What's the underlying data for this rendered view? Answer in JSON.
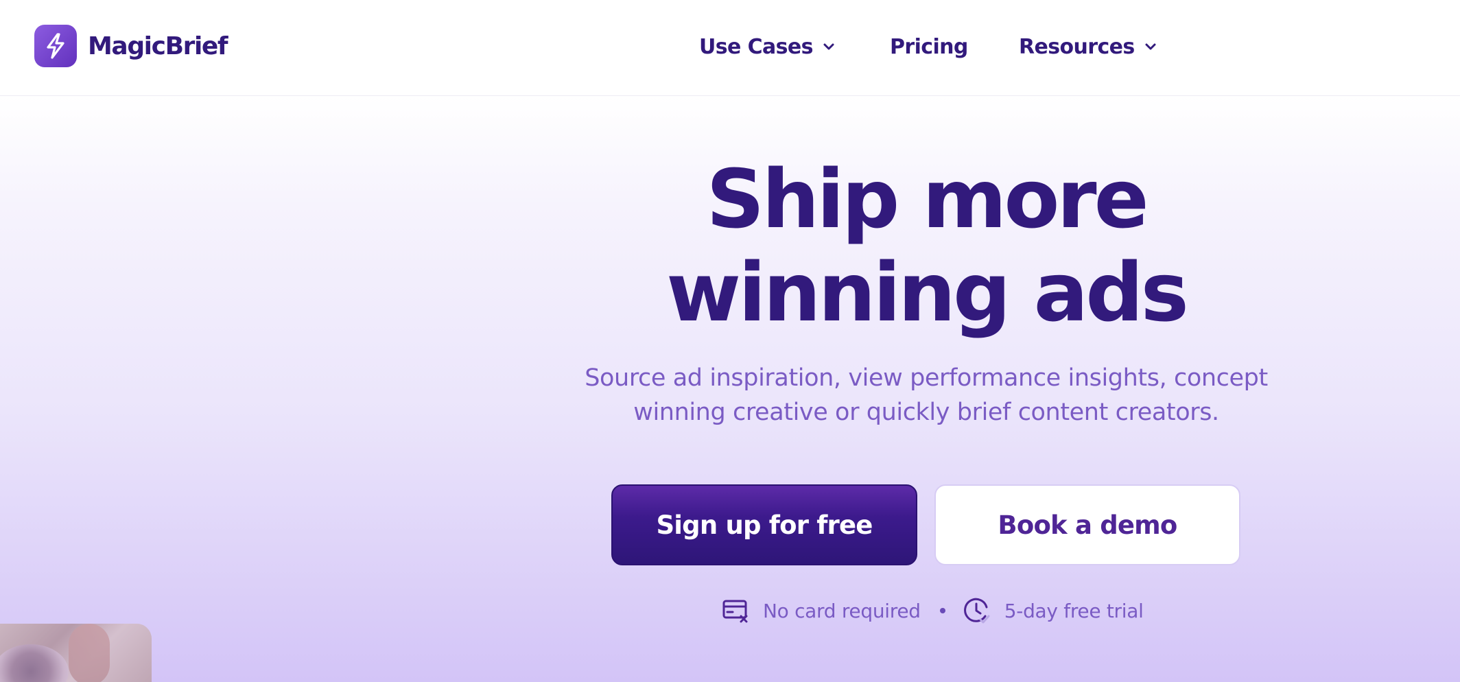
{
  "brand": {
    "name": "MagicBrief",
    "logo_icon": "lightning-bolt-icon",
    "accent": "#321a7c",
    "logo_color": "#7a47d4"
  },
  "nav": {
    "items": [
      {
        "label": "Use Cases",
        "has_dropdown": true
      },
      {
        "label": "Pricing",
        "has_dropdown": false
      },
      {
        "label": "Resources",
        "has_dropdown": true
      }
    ]
  },
  "hero": {
    "headline_line1": "Ship more",
    "headline_line2": "winning ads",
    "subhead_line1": "Source ad inspiration, view performance insights, concept",
    "subhead_line2": "winning creative or quickly brief content creators.",
    "primary_cta": "Sign up for free",
    "secondary_cta": "Book a demo",
    "perks": [
      {
        "icon": "card-x-icon",
        "label": "No card required"
      },
      {
        "icon": "clock-check-icon",
        "label": "5-day free trial"
      }
    ]
  },
  "colors": {
    "headline": "#321a7c",
    "subhead": "#7a5bc4",
    "primary_button": "#3c1a8c",
    "secondary_button_text": "#4f2596"
  }
}
